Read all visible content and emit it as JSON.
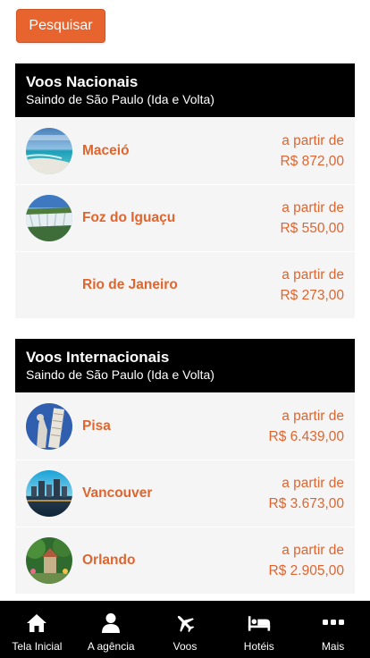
{
  "search": {
    "label": "Pesquisar"
  },
  "national": {
    "title": "Voos Nacionais",
    "subtitle": "Saindo de São Paulo (Ida e Volta)",
    "items": [
      {
        "name": "Maceió",
        "from": "a partir de",
        "price": "R$ 872,00",
        "image": "beach-photo"
      },
      {
        "name": "Foz do Iguaçu",
        "from": "a partir de",
        "price": "R$ 550,00",
        "image": "waterfall-photo"
      },
      {
        "name": "Rio de Janeiro",
        "from": "a partir de",
        "price": "R$ 273,00",
        "image": ""
      }
    ]
  },
  "international": {
    "title": "Voos Internacionais",
    "subtitle": "Saindo de São Paulo (Ida e Volta)",
    "items": [
      {
        "name": "Pisa",
        "from": "a partir de",
        "price": "R$ 6.439,00",
        "image": "pisa-tower-photo"
      },
      {
        "name": "Vancouver",
        "from": "a partir de",
        "price": "R$ 3.673,00",
        "image": "city-skyline-photo"
      },
      {
        "name": "Orlando",
        "from": "a partir de",
        "price": "R$ 2.905,00",
        "image": "theme-park-photo"
      }
    ]
  },
  "nav": [
    {
      "label": "Tela Inicial",
      "icon": "home-icon"
    },
    {
      "label": "A agência",
      "icon": "user-icon"
    },
    {
      "label": "Voos",
      "icon": "airplane-icon"
    },
    {
      "label": "Hotéis",
      "icon": "bed-icon"
    },
    {
      "label": "Mais",
      "icon": "more-icon"
    }
  ],
  "colors": {
    "accent": "#e8642f",
    "header": "#000000",
    "row_bg": "#f5f5f5"
  }
}
